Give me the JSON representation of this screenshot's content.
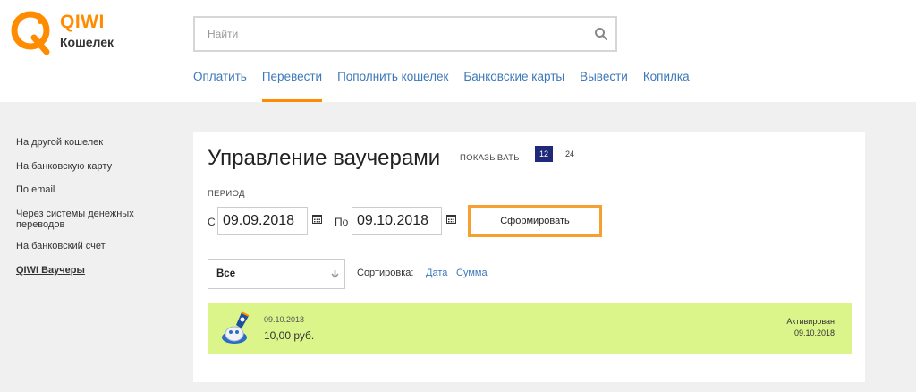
{
  "logo": {
    "brand": "QIWI",
    "sub": "Кошелек"
  },
  "search": {
    "placeholder": "Найти"
  },
  "nav": {
    "items": [
      {
        "label": "Оплатить"
      },
      {
        "label": "Перевести"
      },
      {
        "label": "Пополнить кошелек"
      },
      {
        "label": "Банковские карты"
      },
      {
        "label": "Вывести"
      },
      {
        "label": "Копилка"
      }
    ],
    "active": "Перевести"
  },
  "sidebar": {
    "items": [
      {
        "label": "На другой кошелек"
      },
      {
        "label": "На банковскую карту"
      },
      {
        "label": "По email"
      },
      {
        "label": "Через системы денежных переводов"
      },
      {
        "label": "На банковский счет"
      },
      {
        "label": "QIWI Ваучеры"
      }
    ],
    "active": "QIWI Ваучеры"
  },
  "panel": {
    "title": "Управление ваучерами",
    "show_label": "ПОКАЗЫВАТЬ",
    "show_options": [
      "12",
      "24"
    ],
    "show_selected": "12",
    "period_label": "ПЕРИОД",
    "from_label": "С",
    "from_date": "09.09.2018",
    "to_label": "По",
    "to_date": "09.10.2018",
    "form_button": "Сформировать",
    "filter_value": "Все",
    "sort_label": "Сортировка:",
    "sort_options": [
      "Дата",
      "Сумма"
    ]
  },
  "voucher": {
    "date": "09.10.2018",
    "amount": "10,00 руб.",
    "status": "Активирован",
    "status_date": "09.10.2018"
  },
  "colors": {
    "brand_orange": "#ff8c00",
    "link_blue": "#3d78b8",
    "selected_navy": "#1e2a78",
    "voucher_green": "#dcf58a",
    "button_border": "#f5a030"
  },
  "icons": [
    "qiwi-logo-icon",
    "search-icon",
    "calendar-icon",
    "arrow-down-icon",
    "voucher-icon"
  ]
}
